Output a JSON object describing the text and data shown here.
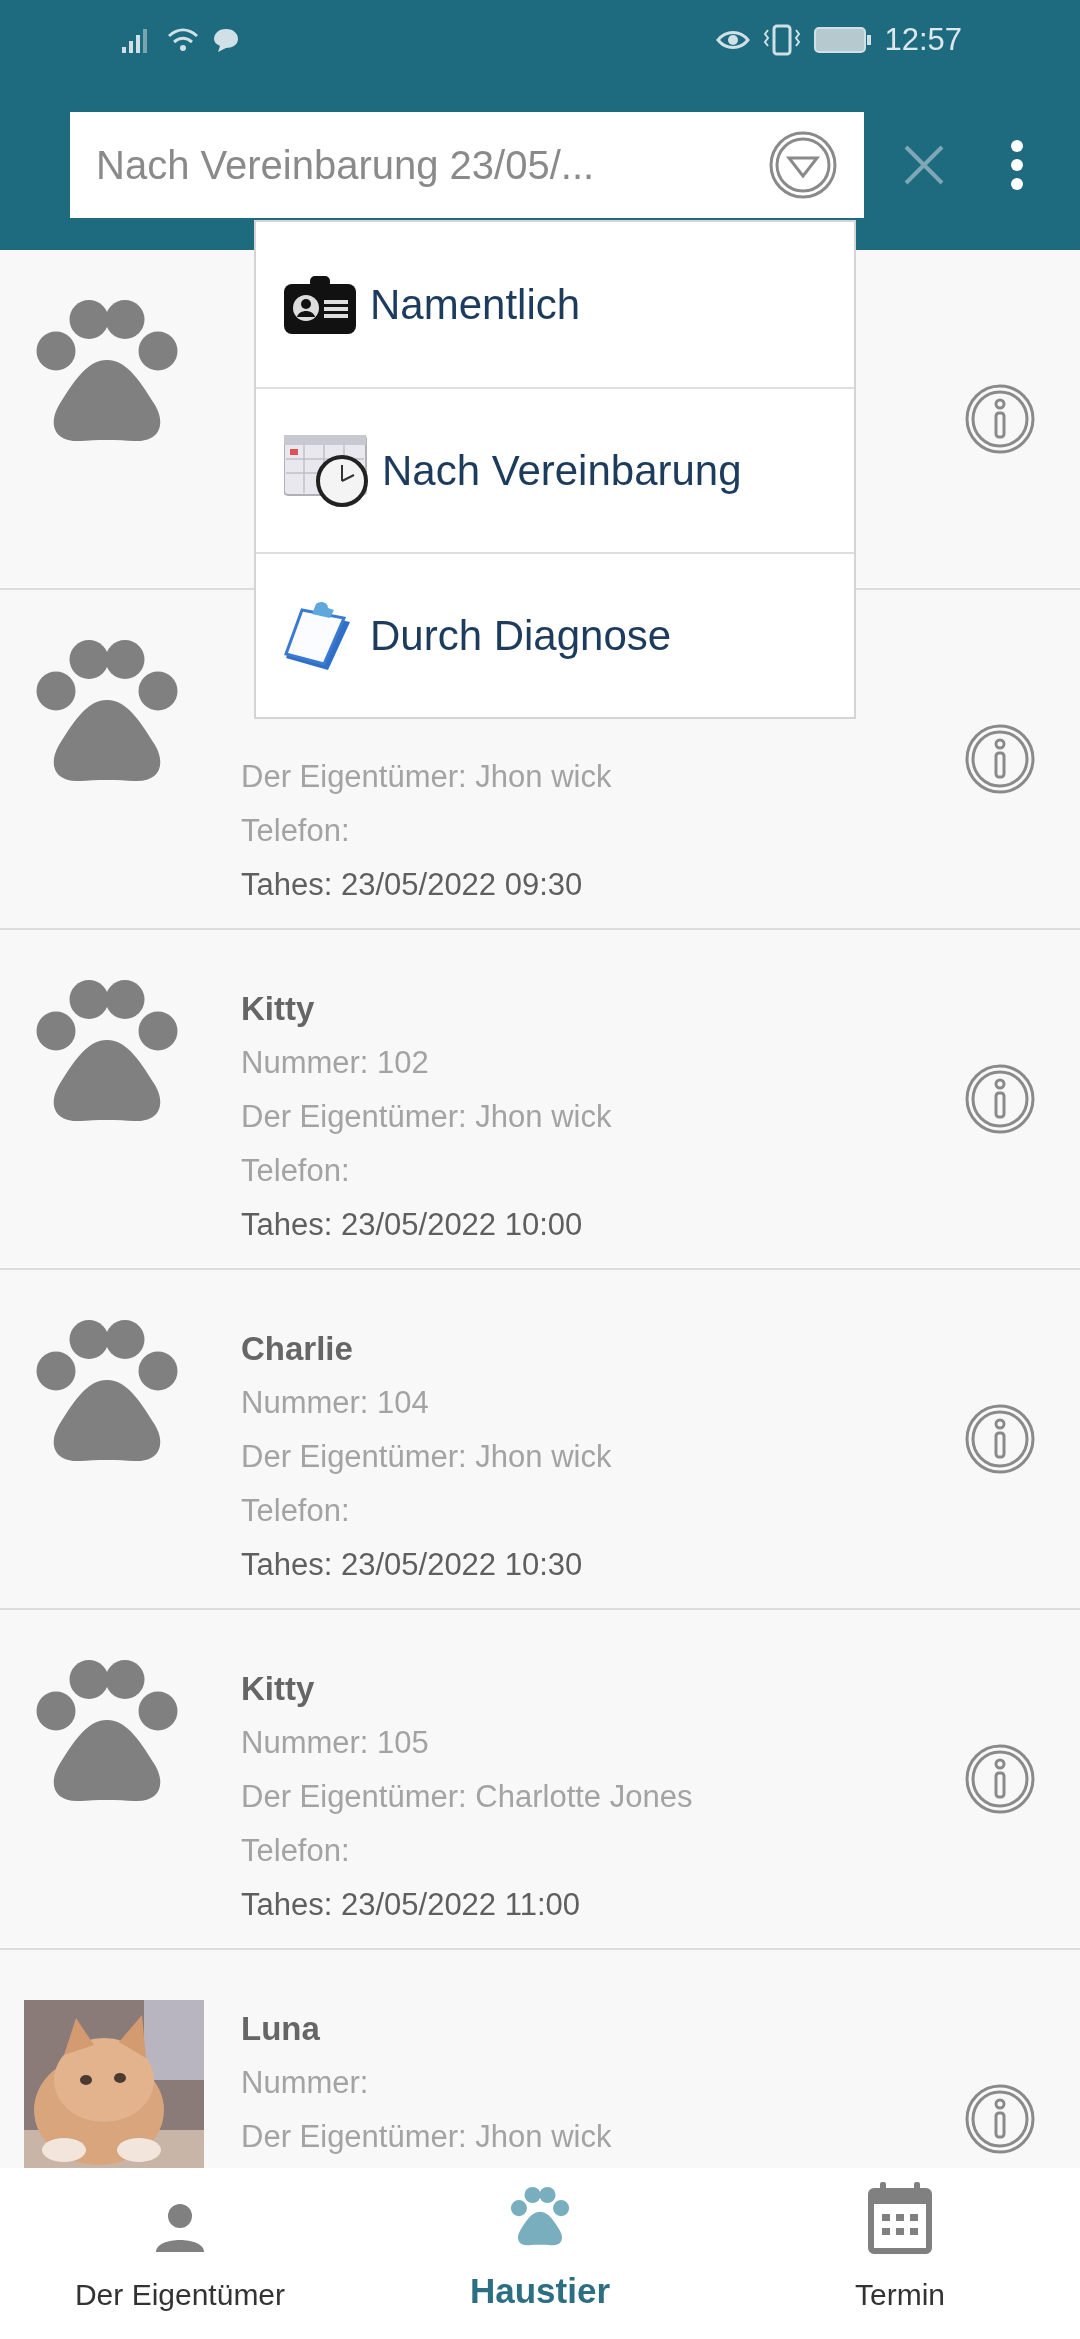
{
  "status_bar": {
    "time": "12:57"
  },
  "search": {
    "value": "Nach Vereinbarung 23/05/..."
  },
  "dropdown": {
    "items": [
      {
        "label": "Namentlich"
      },
      {
        "label": "Nach Vereinbarung"
      },
      {
        "label": "Durch Diagnose"
      }
    ]
  },
  "pets": [
    {
      "kind": "paw"
    },
    {
      "kind": "paw",
      "owner": "Der Eigentümer: Jhon wick",
      "phone": "Telefon:",
      "date": "Tahes: 23/05/2022 09:30"
    },
    {
      "kind": "paw",
      "name": "Kitty",
      "number": "Nummer: 102",
      "owner": "Der Eigentümer: Jhon wick",
      "phone": "Telefon:",
      "date": "Tahes: 23/05/2022 10:00"
    },
    {
      "kind": "paw",
      "name": "Charlie",
      "number": "Nummer: 104",
      "owner": "Der Eigentümer: Jhon wick",
      "phone": "Telefon:",
      "date": "Tahes: 23/05/2022 10:30"
    },
    {
      "kind": "paw",
      "name": "Kitty",
      "number": "Nummer: 105",
      "owner": "Der Eigentümer: Charlotte Jones",
      "phone": "Telefon:",
      "date": "Tahes: 23/05/2022 11:00"
    },
    {
      "kind": "picture",
      "name": "Luna",
      "number": "Nummer:",
      "owner": "Der Eigentümer: Jhon wick"
    }
  ],
  "bottom_nav": [
    {
      "label": "Der Eigentümer",
      "selected": false
    },
    {
      "label": "Haustier",
      "selected": true
    },
    {
      "label": "Termin",
      "selected": false
    }
  ]
}
